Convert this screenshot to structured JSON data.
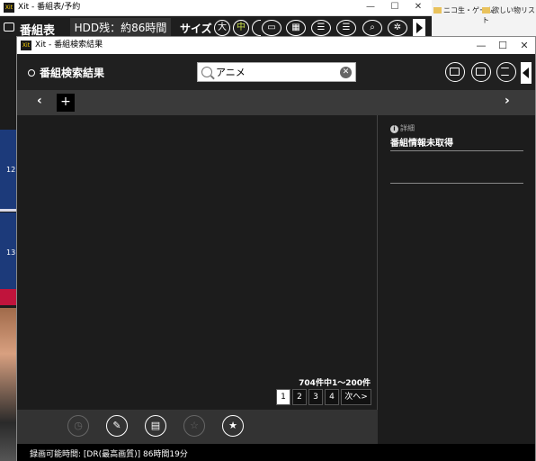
{
  "background_window": {
    "title": "Xit - 番組表/予約",
    "tab_label": "番組表",
    "hdd_label": "HDD残：約86時間",
    "size_label": "サイズ",
    "size_large": "大",
    "size_medium": "中",
    "rows": [
      "12",
      "13"
    ]
  },
  "browser": {
    "bookmarks": [
      "ニコ生・ゲーム",
      "欲しい物リスト"
    ]
  },
  "window": {
    "logo": "Xit",
    "title": "Xit - 番組検索結果",
    "minimize": "—",
    "maximize": "☐",
    "close": "✕"
  },
  "header": {
    "title": "番組検索結果"
  },
  "search": {
    "value": "アニメ",
    "clear": "✕"
  },
  "nav": {
    "prev": "‹",
    "add": "+",
    "next": "›"
  },
  "results": {
    "count_text": "704件中1～200件",
    "pages": [
      "1",
      "2",
      "3",
      "4"
    ],
    "current_page": "1",
    "next_label": "次へ>"
  },
  "detail": {
    "header": "詳細",
    "title": "番組情報未取得"
  },
  "status": {
    "text": "録画可能時間: [DR(最高画質)] 86時間19分"
  }
}
